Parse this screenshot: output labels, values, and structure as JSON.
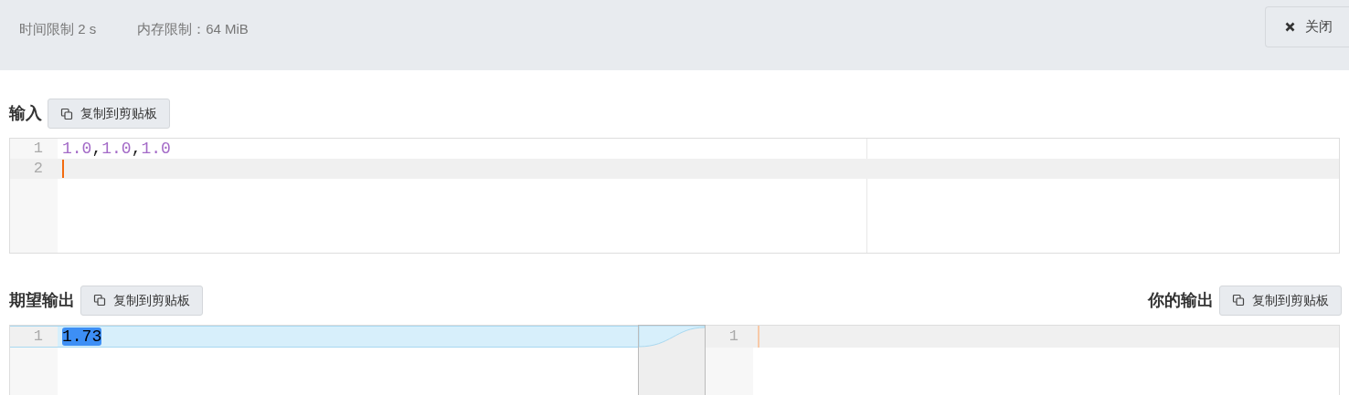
{
  "header": {
    "time_limit": "时间限制 2 s",
    "memory_limit": "内存限制：64 MiB",
    "close_button": "关闭"
  },
  "input": {
    "label": "输入",
    "copy_button": "复制到剪贴板",
    "lines": [
      {
        "number": "1",
        "active": false,
        "tokens": [
          {
            "text": "1.0",
            "kind": "number"
          },
          {
            "text": ",",
            "kind": "punct"
          },
          {
            "text": "1.0",
            "kind": "number"
          },
          {
            "text": ",",
            "kind": "punct"
          },
          {
            "text": "1.0",
            "kind": "number"
          }
        ]
      },
      {
        "number": "2",
        "active": true
      }
    ]
  },
  "expected": {
    "label": "期望输出",
    "copy_button": "复制到剪贴板",
    "lines": [
      {
        "number": "1",
        "text": "1.73",
        "selected": true,
        "changed": true
      }
    ]
  },
  "yours": {
    "label": "你的输出",
    "copy_button": "复制到剪贴板",
    "lines": [
      {
        "number": "1",
        "active": true
      }
    ]
  }
}
